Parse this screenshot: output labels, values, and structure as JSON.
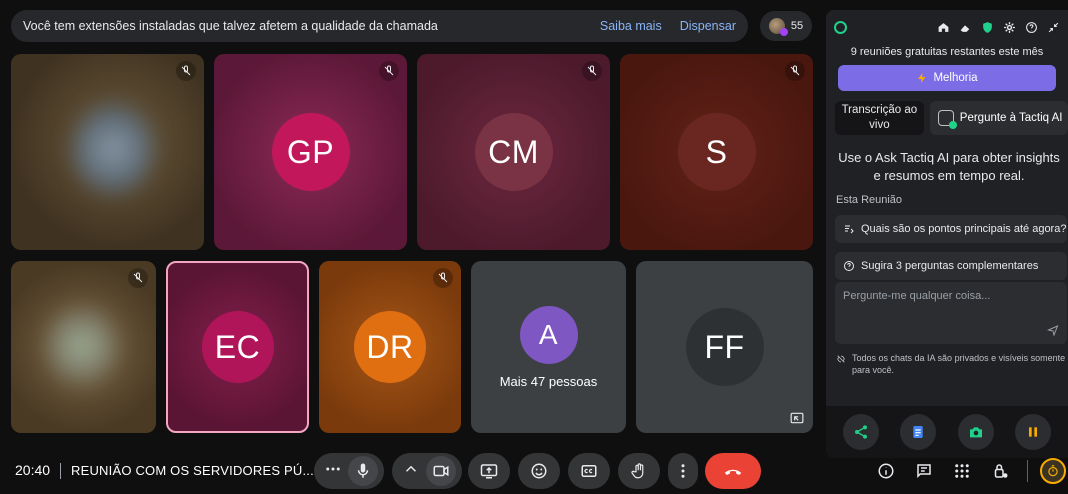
{
  "notice": {
    "text": "Você tem extensões instaladas que talvez afetem a qualidade da chamada",
    "learn_more": "Saiba mais",
    "dismiss": "Dispensar"
  },
  "participant_count": "55",
  "tiles": [
    {
      "initials": "",
      "kind": "video"
    },
    {
      "initials": "GP",
      "color": "#c2185b"
    },
    {
      "initials": "CM",
      "color": "#7a3245"
    },
    {
      "initials": "S",
      "color": "#6a2620"
    },
    {
      "initials": "",
      "kind": "video"
    },
    {
      "initials": "EC",
      "color": "#b0155a"
    },
    {
      "initials": "DR",
      "color": "#e06f12"
    },
    {
      "initials": "A",
      "color": "#7e57c2",
      "caption": "Mais 47 pessoas"
    },
    {
      "initials": "FF",
      "color": "#3c4043"
    }
  ],
  "bottom": {
    "time": "20:40",
    "meeting_name": "REUNIÃO COM OS SERVIDORES PÚ..."
  },
  "panel": {
    "free_note": "9 reuniões gratuitas restantes este mês",
    "upgrade": "Melhoria",
    "tab_live": "Transcrição ao vivo",
    "tab_ask": "Pergunte à Tactiq AI",
    "intro": "Use o Ask Tactiq AI para obter insights e resumos em tempo real.",
    "section": "Esta Reunião",
    "suggest1": "Quais são os pontos principais até agora?",
    "suggest2": "Sugira 3 perguntas complementares",
    "prompt_placeholder": "Pergunte-me qualquer coisa...",
    "privacy": "Todos os chats da IA são privados e visíveis somente para você."
  },
  "colors": {
    "accent_green": "#1fd18b",
    "upgrade_purple": "#7c6ce6",
    "hangup_red": "#ea4335",
    "link_blue": "#8ab4f8"
  }
}
